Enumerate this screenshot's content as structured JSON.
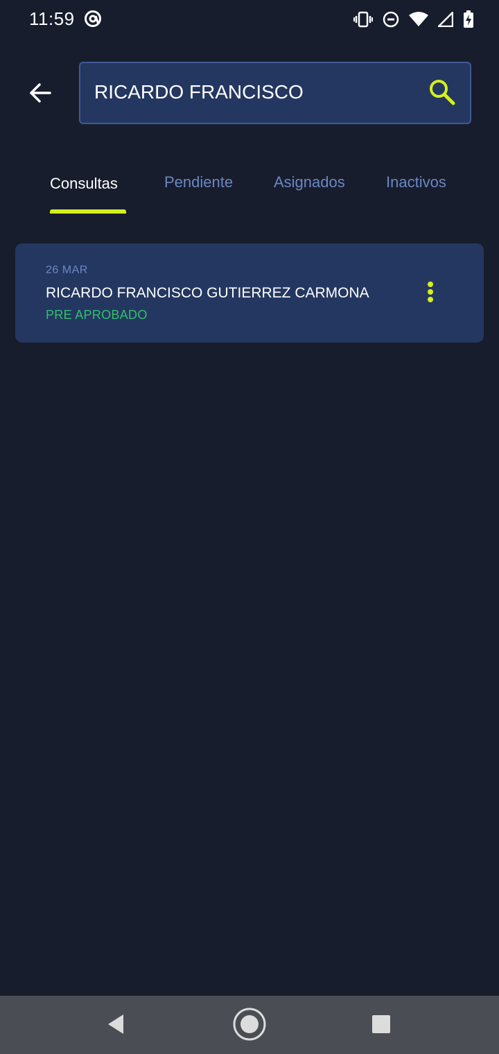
{
  "status_bar": {
    "time": "11:59",
    "icons": [
      "at-sign-icon",
      "vibrate-icon",
      "do-not-disturb-icon",
      "wifi-icon",
      "signal-icon",
      "battery-charging-icon"
    ]
  },
  "header": {
    "back_icon": "arrow-left-icon",
    "search": {
      "value": "RICARDO FRANCISCO",
      "icon": "search-icon"
    }
  },
  "tabs": [
    {
      "label": "Consultas",
      "active": true
    },
    {
      "label": "Pendiente",
      "active": false
    },
    {
      "label": "Asignados",
      "active": false
    },
    {
      "label": "Inactivos",
      "active": false
    }
  ],
  "results": [
    {
      "date": "26 MAR",
      "name": "RICARDO FRANCISCO GUTIERREZ CARMONA",
      "status": "PRE APROBADO",
      "menu_icon": "more-vertical-icon"
    }
  ],
  "colors": {
    "background": "#171d2d",
    "card": "#243761",
    "accent": "#d4f01c",
    "status_approved": "#2fc26b",
    "tab_inactive": "#6b87c4"
  },
  "nav_bar": {
    "icons": [
      "nav-back-icon",
      "nav-home-icon",
      "nav-recents-icon"
    ]
  }
}
